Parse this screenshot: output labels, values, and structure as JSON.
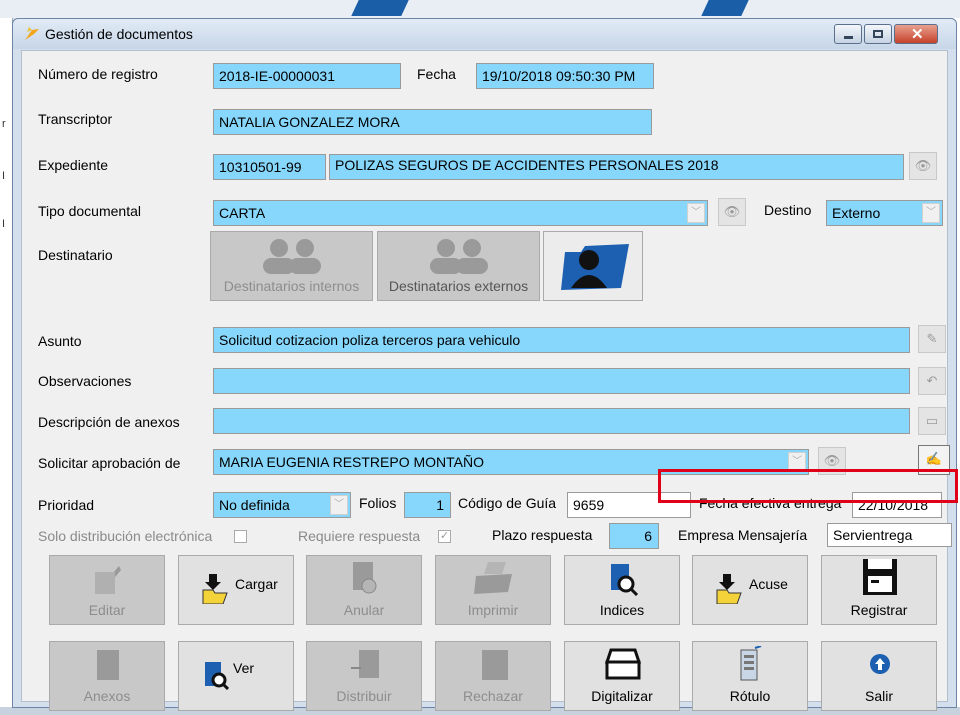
{
  "window": {
    "title": "Gestión de documentos"
  },
  "form": {
    "numero_registro": {
      "label": "Número de registro",
      "value": "2018-IE-00000031"
    },
    "fecha": {
      "label": "Fecha",
      "value": "19/10/2018 09:50:30 PM"
    },
    "transcriptor": {
      "label": "Transcriptor",
      "value": "NATALIA GONZALEZ MORA"
    },
    "expediente": {
      "label": "Expediente",
      "code": "10310501-99",
      "name": "POLIZAS SEGUROS DE ACCIDENTES PERSONALES 2018"
    },
    "tipo_documental": {
      "label": "Tipo documental",
      "value": "CARTA"
    },
    "destino": {
      "label": "Destino",
      "value": "Externo"
    },
    "destinatario": {
      "label": "Destinatario",
      "internos": "Destinatarios internos",
      "externos": "Destinatarios externos"
    },
    "asunto": {
      "label": "Asunto",
      "value": "Solicitud cotizacion poliza terceros para vehiculo"
    },
    "observaciones": {
      "label": "Observaciones",
      "value": ""
    },
    "descripcion_anexos": {
      "label": "Descripción de anexos",
      "value": ""
    },
    "solicitar_aprobacion": {
      "label": "Solicitar aprobación de",
      "value": "MARIA EUGENIA RESTREPO MONTAÑO"
    },
    "prioridad": {
      "label": "Prioridad",
      "value": "No definida"
    },
    "folios": {
      "label": "Folios",
      "value": "1"
    },
    "codigo_guia": {
      "label": "Código de Guía",
      "value": "9659"
    },
    "fecha_efectiva": {
      "label": "Fecha efectiva entrega",
      "value": "22/10/2018"
    },
    "solo_distribucion": {
      "label": "Solo distribución electrónica",
      "checked": false
    },
    "requiere_respuesta": {
      "label": "Requiere respuesta",
      "checked": true
    },
    "plazo_respuesta": {
      "label": "Plazo respuesta",
      "value": "6"
    },
    "empresa_mensajeria": {
      "label": "Empresa Mensajería",
      "value": "Servientrega"
    }
  },
  "buttons": {
    "editar": "Editar",
    "cargar": "Cargar",
    "anular": "Anular",
    "imprimir": "Imprimir",
    "indices": "Indices",
    "acuse": "Acuse",
    "registrar": "Registrar",
    "anexos": "Anexos",
    "ver": "Ver",
    "distribuir": "Distribuir",
    "rechazar": "Rechazar",
    "digitalizar": "Digitalizar",
    "rotulo": "Rótulo",
    "salir": "Salir"
  },
  "colors": {
    "field": "#87d7fc",
    "highlight": "#e0001a",
    "folder": "#1d5fb0"
  }
}
